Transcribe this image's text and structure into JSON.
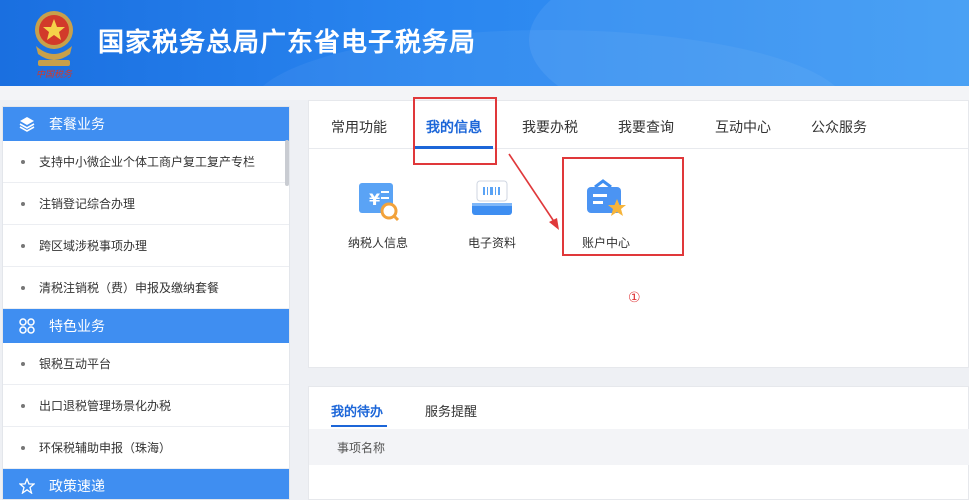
{
  "header": {
    "title": "国家税务总局广东省电子税务局",
    "emblem_text": "中国税务"
  },
  "sidebar": {
    "sections": [
      {
        "label": "套餐业务",
        "icon": "layers-icon",
        "items": [
          "支持中小微企业个体工商户复工复产专栏",
          "注销登记综合办理",
          "跨区域涉税事项办理",
          "清税注销税（费）申报及缴纳套餐"
        ]
      },
      {
        "label": "特色业务",
        "icon": "grid-icon",
        "items": [
          "银税互动平台",
          "出口退税管理场景化办税",
          "环保税辅助申报（珠海）"
        ]
      },
      {
        "label": "政策速递",
        "icon": "star-icon",
        "items": []
      }
    ]
  },
  "main": {
    "tabs": [
      "常用功能",
      "我的信息",
      "我要办税",
      "我要查询",
      "互动中心",
      "公众服务"
    ],
    "active_tab": "我的信息",
    "apps": [
      {
        "label": "纳税人信息",
        "icon": "taxpayer-info-icon"
      },
      {
        "label": "电子资料",
        "icon": "e-documents-icon"
      },
      {
        "label": "账户中心",
        "icon": "account-center-icon"
      }
    ],
    "annotation": "①"
  },
  "todo": {
    "tabs": [
      "我的待办",
      "服务提醒"
    ],
    "active_tab": "我的待办",
    "columns": [
      "事项名称"
    ]
  },
  "colors": {
    "accent": "#1c66d8",
    "sidebar_head": "#3f8ef1",
    "highlight": "#e0383a"
  }
}
